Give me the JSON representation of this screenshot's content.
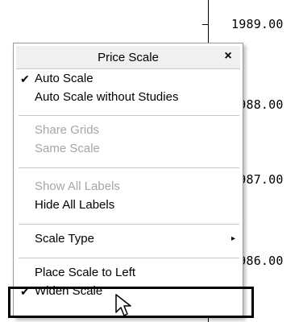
{
  "scale": {
    "labels": [
      "1989.00",
      "1988.00",
      "1987.00",
      "1986.00"
    ]
  },
  "menu": {
    "title": "Price Scale",
    "close_glyph": "×",
    "check_glyph": "✔",
    "items": [
      {
        "label": "Auto Scale",
        "checked": true,
        "enabled": true
      },
      {
        "label": "Auto Scale without Studies",
        "checked": false,
        "enabled": true
      },
      {
        "label": "Share Grids",
        "checked": false,
        "enabled": false
      },
      {
        "label": "Same Scale",
        "checked": false,
        "enabled": false
      },
      {
        "label": "Show All Labels",
        "checked": false,
        "enabled": false
      },
      {
        "label": "Hide All Labels",
        "checked": false,
        "enabled": true
      },
      {
        "label": "Scale Type",
        "checked": false,
        "enabled": true,
        "submenu": true
      },
      {
        "label": "Place Scale to Left",
        "checked": false,
        "enabled": true
      },
      {
        "label": "Widen Scale",
        "checked": true,
        "enabled": true
      }
    ],
    "submenu_glyph": "▸"
  },
  "colors": {
    "disabled_text": "#a6a6a6",
    "highlight_border": "#000000"
  },
  "icons": {
    "cursor": "arrow-cursor-icon"
  }
}
